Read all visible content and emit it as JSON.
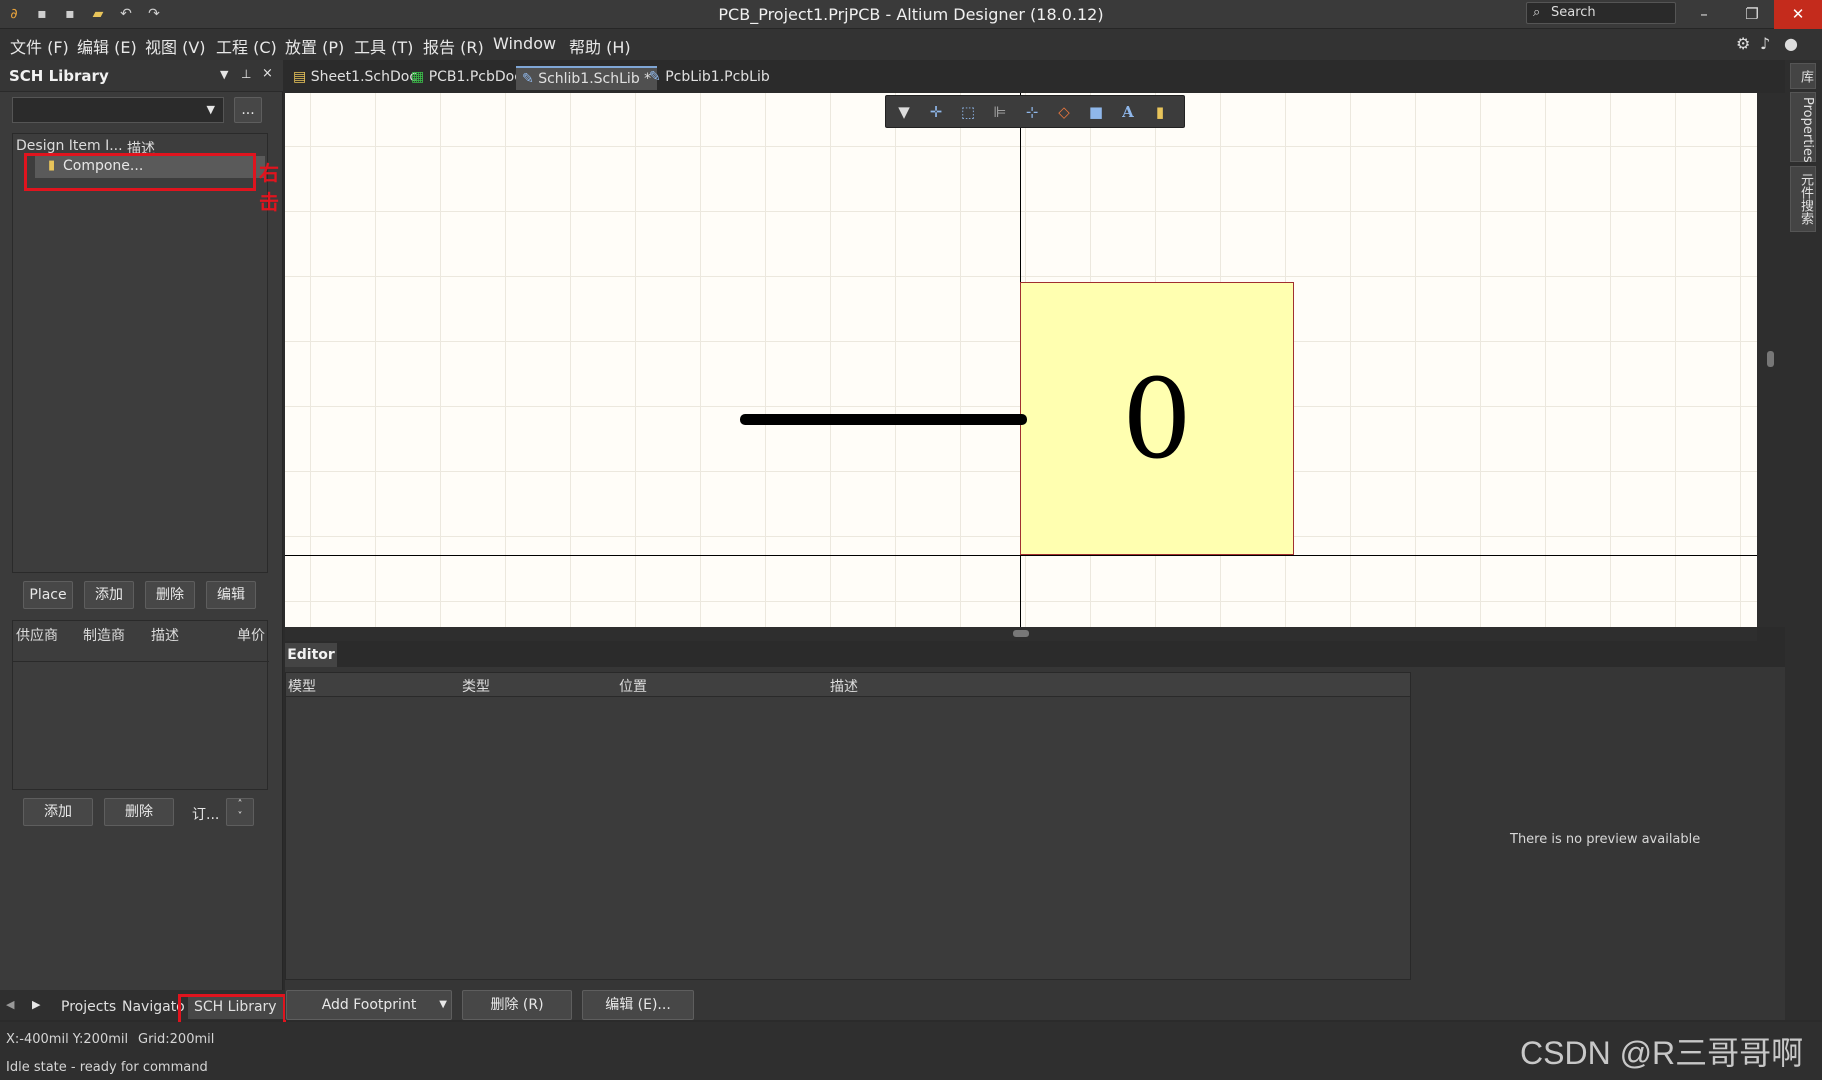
{
  "title": "PCB_Project1.PrjPCB - Altium Designer (18.0.12)",
  "search_placeholder": "Search",
  "menu": [
    "文件 (F)",
    "编辑 (E)",
    "视图 (V)",
    "工程 (C)",
    "放置 (P)",
    "工具 (T)",
    "报告 (R)",
    "Window",
    "帮助 (H)"
  ],
  "left_panel": {
    "title": "SCH Library",
    "browse_label": "...",
    "list_headers": [
      "Design Item I...",
      "描述"
    ],
    "items": [
      "Compone..."
    ],
    "annotation": "右击",
    "buttons": [
      "Place",
      "添加",
      "删除",
      "编辑"
    ],
    "supplier_headers": [
      "供应商",
      "制造商",
      "描述",
      "单价"
    ],
    "supplier_buttons": [
      "添加",
      "删除",
      "订..."
    ]
  },
  "doc_tabs": [
    "Sheet1.SchDoc",
    "PCB1.PcbDoc",
    "Schlib1.SchLib *",
    "PcbLib1.PcbLib"
  ],
  "component_label": "0",
  "editor": {
    "title": "Editor",
    "headers": [
      "模型",
      "类型",
      "位置",
      "描述"
    ],
    "preview": "There is no preview available",
    "buttons": [
      "Add Footprint",
      "删除 (R)",
      "编辑 (E)..."
    ]
  },
  "right_tabs": [
    "库",
    "Properties",
    "元件搜索"
  ],
  "bottom_tabs": [
    "Projects",
    "Navigato",
    "SCH Library"
  ],
  "status": {
    "coords": "X:-400mil Y:200mil",
    "grid": "Grid:200mil",
    "state": "Idle state - ready for command"
  },
  "watermark": "CSDN @R三哥哥啊",
  "colors": {
    "component_fill": "#ffffb0",
    "highlight": "#e0141e",
    "canvas": "#fffdf8"
  }
}
